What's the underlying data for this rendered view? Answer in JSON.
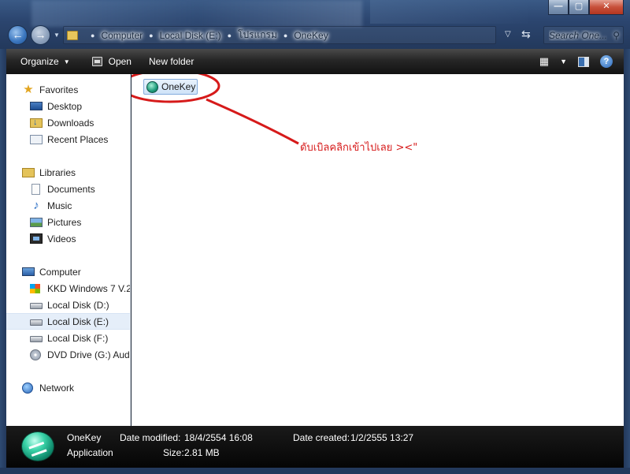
{
  "window": {
    "min_label": "—",
    "max_label": "▢",
    "close_label": "✕"
  },
  "nav": {
    "back_icon": "left-arrow-icon",
    "forward_icon": "right-arrow-icon"
  },
  "address": {
    "breadcrumbs": [
      "Computer",
      "Local Disk (E:)",
      "โปรแกรม",
      "OneKey"
    ]
  },
  "search": {
    "placeholder": "Search One..."
  },
  "toolbar": {
    "organize_label": "Organize",
    "open_label": "Open",
    "new_folder_label": "New folder"
  },
  "sidebar": {
    "favorites": {
      "label": "Favorites",
      "items": [
        "Desktop",
        "Downloads",
        "Recent Places"
      ]
    },
    "libraries": {
      "label": "Libraries",
      "items": [
        "Documents",
        "Music",
        "Pictures",
        "Videos"
      ]
    },
    "computer": {
      "label": "Computer",
      "items": [
        "KKD Windows 7 V.2",
        "Local Disk (D:)",
        "Local Disk (E:)",
        "Local Disk (F:)",
        "DVD Drive (G:) Audio"
      ],
      "selected": "Local Disk (E:)"
    },
    "network": {
      "label": "Network"
    }
  },
  "content": {
    "items": [
      {
        "name": "OneKey"
      }
    ],
    "annotation_text": "ดับเบิลคลิกเข้าไปเลย   ><\"",
    "annotation_color": "#d61a1a"
  },
  "details": {
    "name": "OneKey",
    "type": "Application",
    "date_modified_label": "Date modified:",
    "date_modified": "18/4/2554 16:08",
    "date_created_label": "Date created:",
    "date_created": "1/2/2555 13:27",
    "size_label": "Size:",
    "size": "2.81 MB"
  }
}
